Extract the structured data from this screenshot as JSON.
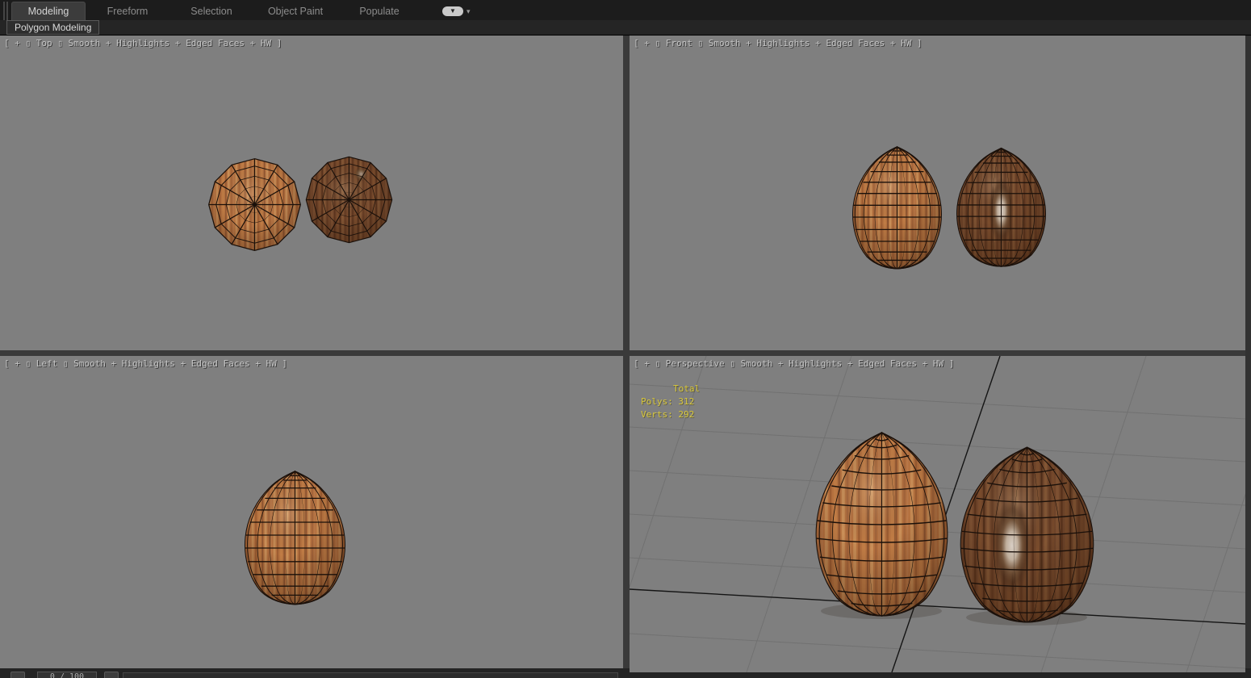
{
  "ribbon": {
    "tabs": [
      {
        "label": "Modeling",
        "active": true
      },
      {
        "label": "Freeform",
        "active": false
      },
      {
        "label": "Selection",
        "active": false
      },
      {
        "label": "Object Paint",
        "active": false
      },
      {
        "label": "Populate",
        "active": false
      }
    ],
    "panel_tab": "Polygon Modeling",
    "icons": {
      "minimize_ribbon": "▼",
      "dropdown_caret": "▾"
    }
  },
  "viewports": {
    "top": {
      "label": "[ + ▯ Top ▯ Smooth + Highlights + Edged Faces + HW ]"
    },
    "front": {
      "label": "[ + ▯ Front ▯ Smooth + Highlights + Edged Faces + HW ]"
    },
    "left": {
      "label": "[ + ▯ Left ▯ Smooth + Highlights + Edged Faces + HW ]"
    },
    "perspective": {
      "label": "[ + ▯ Perspective ▯ Smooth + Highlights + Edged Faces + HW ]",
      "stats": {
        "total": "Total",
        "polys": "Polys: 312",
        "verts": "Verts: 292"
      }
    }
  },
  "timeline": {
    "frame": "0 / 100"
  },
  "colors": {
    "viewport_bg": "#7F7F7F",
    "stats_text": "#D9C83C",
    "wood_light": "#B5713F",
    "wood_dark": "#70452A",
    "wireframe": "#1A100A"
  }
}
